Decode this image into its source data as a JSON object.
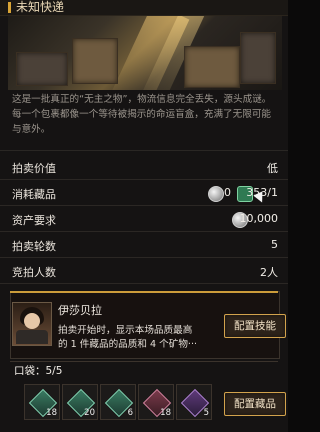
{
  "header": {
    "title": "未知快递"
  },
  "description": "这是一批真正的“无主之物”，物流信息完全丢失，源头成谜。每一个包裹都像一个等待被揭示的命运盲盒，充满了无限可能与意外。",
  "rows": [
    {
      "label": "拍卖价值",
      "value": "低"
    },
    {
      "label": "消耗藏品",
      "value_left": "0",
      "value_right": "353/1"
    },
    {
      "label": "资产要求",
      "value": "10,000"
    },
    {
      "label": "拍卖轮数",
      "value": "5"
    },
    {
      "label": "竞拍人数",
      "value": "2人"
    }
  ],
  "character": {
    "name": "伊莎贝拉",
    "desc_line1": "拍卖开始时，显示本场品质最高",
    "desc_line2": "的 1 件藏品的品质和 4 个矿物···",
    "button": "配置技能"
  },
  "bag": {
    "label": "口袋：5/5",
    "button": "配置藏品",
    "items": [
      {
        "count": "18",
        "color": "green"
      },
      {
        "count": "20",
        "color": "green"
      },
      {
        "count": "6",
        "color": "green"
      },
      {
        "count": "18",
        "color": "red"
      },
      {
        "count": "5",
        "color": "purple"
      }
    ]
  },
  "icons": {
    "silver_coin": "silver-coin-icon",
    "green_token": "green-token-icon",
    "cursor": "mouse-cursor-icon"
  },
  "colors": {
    "accent": "#d9a436",
    "button_border": "#d3a34d"
  }
}
